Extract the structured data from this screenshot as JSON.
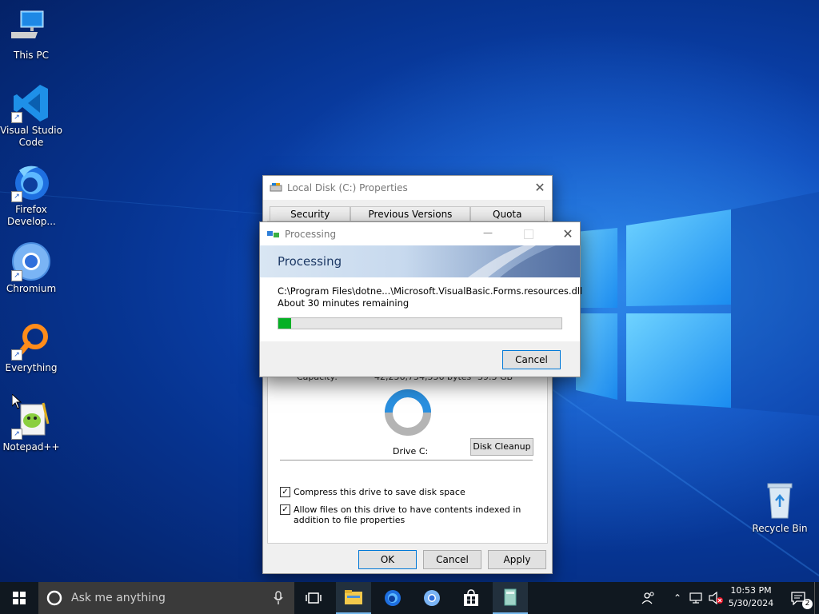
{
  "desktop": {
    "icons": [
      {
        "label": "This PC",
        "icon": "computer-icon"
      },
      {
        "label": "Visual Studio Code",
        "icon": "vscode-icon"
      },
      {
        "label": "Firefox Develop...",
        "icon": "firefox-developer-icon"
      },
      {
        "label": "Chromium",
        "icon": "chromium-icon"
      },
      {
        "label": "Everything",
        "icon": "everything-search-icon"
      },
      {
        "label": "Notepad++",
        "icon": "notepadpp-icon"
      },
      {
        "label": "Recycle Bin",
        "icon": "recycle-bin-icon"
      }
    ]
  },
  "properties": {
    "title": "Local Disk (C:) Properties",
    "tabs": [
      "Security",
      "Previous Versions",
      "Quota"
    ],
    "capacity_label": "Capacity:",
    "capacity_bytes": "42,256,754,556 bytes",
    "capacity_gb": "39.3 GB",
    "drive_label": "Drive C:",
    "disk_cleanup": "Disk Cleanup",
    "compress_label": "Compress this drive to save disk space",
    "index_label": "Allow files on this drive to have contents indexed in addition to file properties",
    "compress_checked": true,
    "index_checked": true,
    "ok": "OK",
    "cancel": "Cancel",
    "apply": "Apply"
  },
  "processing": {
    "title": "Processing",
    "heading": "Processing",
    "file": "C:\\Program Files\\dotne...\\Microsoft.VisualBasic.Forms.resources.dll",
    "remaining": "About 30 minutes remaining",
    "progress_fraction": 0.045,
    "cancel": "Cancel"
  },
  "taskbar": {
    "search_placeholder": "Ask me anything",
    "time": "10:53 PM",
    "date": "5/30/2024",
    "notification_count": "2"
  },
  "colors": {
    "accent": "#0078d7",
    "progress": "#06b025"
  }
}
